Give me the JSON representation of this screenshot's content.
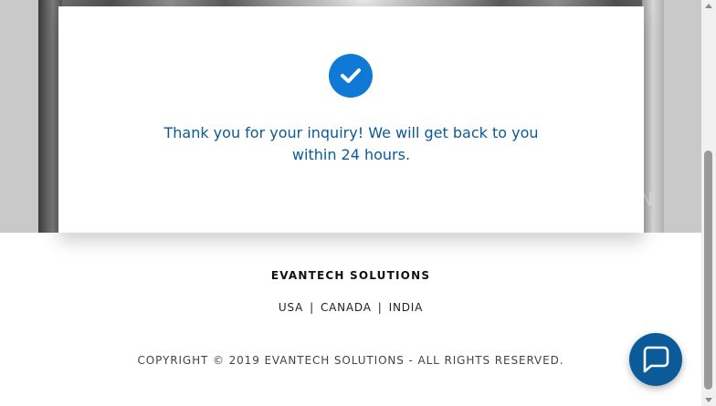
{
  "modal": {
    "message": "Thank you for your inquiry! We will get back to you within 24 hours.",
    "icon": "check-circle-icon",
    "accent_color": "#0f7ad6",
    "text_color": "#0a5a96"
  },
  "hero": {
    "overlay_letter": "N"
  },
  "footer": {
    "brand": "EVANTECH SOLUTIONS",
    "regions": [
      "USA",
      "CANADA",
      "INDIA"
    ],
    "separator": "|",
    "copyright": "COPYRIGHT © 2019 EVANTECH SOLUTIONS - ALL RIGHTS RESERVED."
  },
  "chat": {
    "icon": "chat-bubble-icon",
    "color": "#0b5a9a"
  }
}
